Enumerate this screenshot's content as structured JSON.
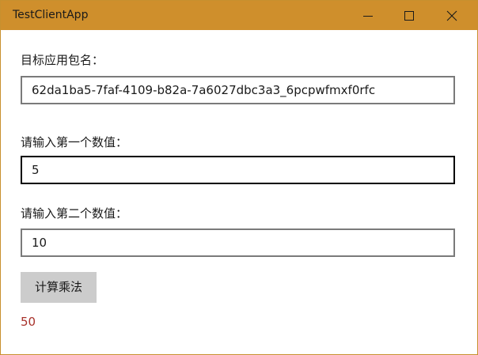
{
  "window": {
    "title": "TestClientApp",
    "titlebar_color": "#cf8f2c"
  },
  "caption_buttons": {
    "minimize_icon": "minimize-icon",
    "maximize_icon": "maximize-icon",
    "close_icon": "close-icon"
  },
  "form": {
    "package_label": "目标应用包名：",
    "package_value": "62da1ba5-7faf-4109-b82a-7a6027dbc3a3_6pcpwfmxf0rfc",
    "number1_label": "请输入第一个数值：",
    "number1_value": "5",
    "number2_label": "请输入第二个数值：",
    "number2_value": "10",
    "calculate_label": "计算乘法",
    "result": "50",
    "result_color": "#a8322b"
  }
}
